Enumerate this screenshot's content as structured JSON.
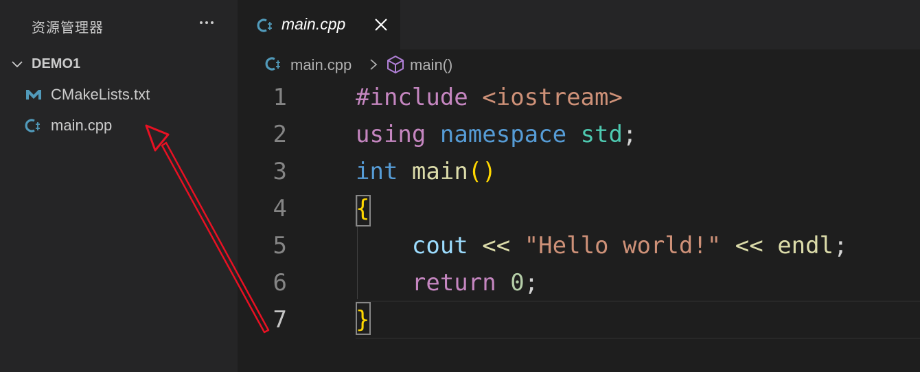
{
  "sidebar": {
    "title": "资源管理器",
    "folder_name": "DEMO1",
    "files": [
      {
        "name": "CMakeLists.txt",
        "icon": "cmake-icon"
      },
      {
        "name": "main.cpp",
        "icon": "cpp-file-icon"
      }
    ]
  },
  "tabs": [
    {
      "label": "main.cpp",
      "icon": "cpp-file-icon",
      "active": true
    }
  ],
  "breadcrumbs": {
    "file": "main.cpp",
    "symbol": "main()"
  },
  "editor": {
    "line_numbers": [
      "1",
      "2",
      "3",
      "4",
      "5",
      "6",
      "7"
    ],
    "active_line": "7",
    "lines": [
      [
        {
          "t": "#include",
          "c": "pre"
        },
        {
          "t": " ",
          "c": "plain"
        },
        {
          "t": "<iostream>",
          "c": "str"
        }
      ],
      [
        {
          "t": "using",
          "c": "pre"
        },
        {
          "t": " ",
          "c": "plain"
        },
        {
          "t": "namespace",
          "c": "blue"
        },
        {
          "t": " ",
          "c": "plain"
        },
        {
          "t": "std",
          "c": "type"
        },
        {
          "t": ";",
          "c": "plain"
        }
      ],
      [
        {
          "t": "int",
          "c": "blue"
        },
        {
          "t": " ",
          "c": "plain"
        },
        {
          "t": "main",
          "c": "fn"
        },
        {
          "t": "()",
          "c": "br"
        }
      ],
      [
        {
          "t": "{",
          "c": "br"
        }
      ],
      [
        {
          "t": "    ",
          "c": "plain"
        },
        {
          "t": "cout",
          "c": "var"
        },
        {
          "t": " ",
          "c": "plain"
        },
        {
          "t": "<<",
          "c": "fn"
        },
        {
          "t": " ",
          "c": "plain"
        },
        {
          "t": "\"Hello world!\"",
          "c": "str"
        },
        {
          "t": " ",
          "c": "plain"
        },
        {
          "t": "<<",
          "c": "fn"
        },
        {
          "t": " ",
          "c": "plain"
        },
        {
          "t": "endl",
          "c": "fn"
        },
        {
          "t": ";",
          "c": "plain"
        }
      ],
      [
        {
          "t": "    ",
          "c": "plain"
        },
        {
          "t": "return",
          "c": "pre"
        },
        {
          "t": " ",
          "c": "plain"
        },
        {
          "t": "0",
          "c": "num"
        },
        {
          "t": ";",
          "c": "plain"
        }
      ],
      [
        {
          "t": "}",
          "c": "br"
        }
      ]
    ]
  },
  "colors": {
    "annotation_arrow": "#e81123",
    "cpp_icon": "#519aba",
    "cmake_icon": "#519aba"
  }
}
